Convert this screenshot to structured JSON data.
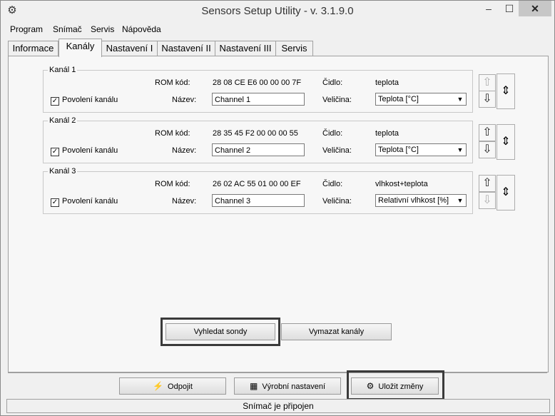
{
  "window": {
    "title": "Sensors Setup Utility - v. 3.1.9.0",
    "minimize": "–",
    "maximize": "☐",
    "close": "✕"
  },
  "menu": [
    "Program",
    "Snímač",
    "Servis",
    "Nápověda"
  ],
  "tabs": [
    "Informace",
    "Kanály",
    "Nastavení I",
    "Nastavení II",
    "Nastavení III",
    "Servis"
  ],
  "active_tab": "Kanály",
  "labels": {
    "rom": "ROM kód:",
    "sensor": "Čidlo:",
    "name": "Název:",
    "quantity": "Veličina:",
    "enable": "Povolení kanálu"
  },
  "channels": [
    {
      "title": "Kanál 1",
      "rom": "28 08 CE E6 00 00 00 7F",
      "sensor": "teplota",
      "name": "Channel 1",
      "quantity": "Teplota [°C]",
      "enabled": "✓"
    },
    {
      "title": "Kanál 2",
      "rom": "28 35 45 F2 00 00 00 55",
      "sensor": "teplota",
      "name": "Channel 2",
      "quantity": "Teplota [°C]",
      "enabled": "✓"
    },
    {
      "title": "Kanál 3",
      "rom": "26 02 AC 55 01 00 00 EF",
      "sensor": "vlhkost+teplota",
      "name": "Channel 3",
      "quantity": "Relativní vlhkost [%]",
      "enabled": "✓"
    }
  ],
  "arrows": {
    "up": "⇧",
    "down": "⇩",
    "swap": "⇕"
  },
  "buttons": {
    "search": "Vyhledat sondy",
    "clear": "Vymazat kanály",
    "disconnect": "Odpojit",
    "factory": "Výrobní nastavení",
    "save": "Uložit změny"
  },
  "status": "Snímač je připojen"
}
